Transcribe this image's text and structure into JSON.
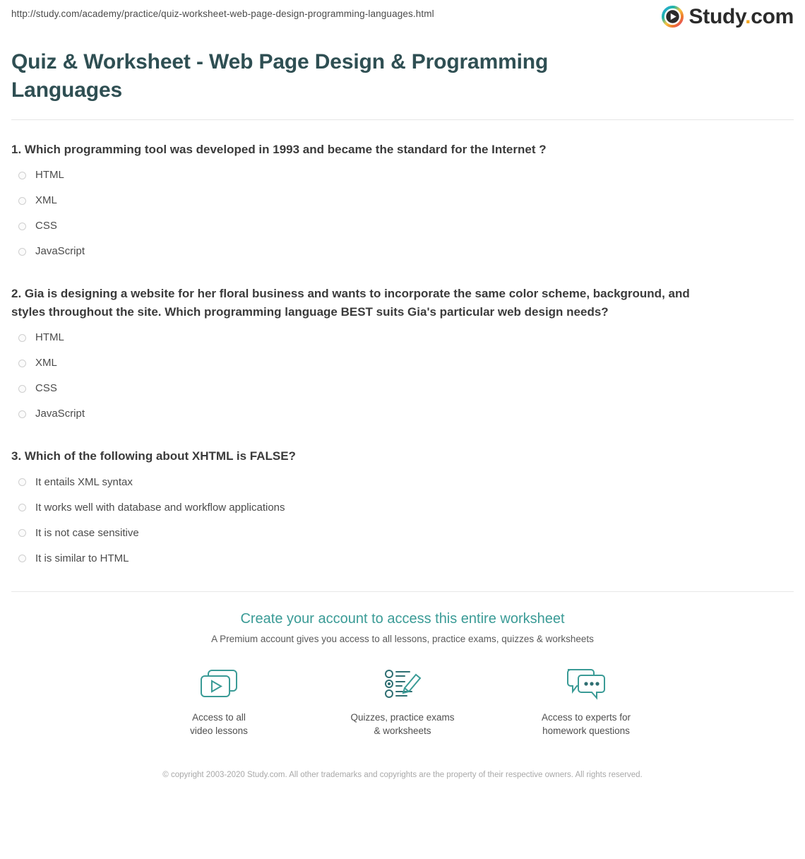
{
  "header": {
    "url": "http://study.com/academy/practice/quiz-worksheet-web-page-design-programming-languages.html",
    "logo_text": "Study",
    "logo_dot": ".",
    "logo_suffix": "com",
    "logo_icon": "play-circle-icon"
  },
  "page_title": "Quiz & Worksheet - Web Page Design & Programming Languages",
  "questions": [
    {
      "text": "1. Which programming tool was developed in 1993 and became the standard for the Internet ?",
      "options": [
        "HTML",
        "XML",
        "CSS",
        "JavaScript"
      ]
    },
    {
      "text": "2. Gia is designing a website for her floral business and wants to incorporate the same color scheme, background, and styles throughout the site. Which programming language BEST suits Gia's particular web design needs?",
      "options": [
        "HTML",
        "XML",
        "CSS",
        "JavaScript"
      ]
    },
    {
      "text": "3. Which of the following about XHTML is FALSE?",
      "options": [
        "It entails XML syntax",
        "It works well with database and workflow applications",
        "It is not case sensitive",
        "It is similar to HTML"
      ]
    }
  ],
  "cta": {
    "title": "Create your account to access this entire worksheet",
    "subtitle": "A Premium account gives you access to all lessons, practice exams, quizzes & worksheets",
    "features": [
      {
        "icon": "video-lessons-icon",
        "label_line1": "Access to all",
        "label_line2": "video lessons"
      },
      {
        "icon": "quiz-pencil-icon",
        "label_line1": "Quizzes, practice exams",
        "label_line2": "& worksheets"
      },
      {
        "icon": "chat-bubbles-icon",
        "label_line1": "Access to experts for",
        "label_line2": "homework questions"
      }
    ]
  },
  "copyright": "© copyright 2003-2020 Study.com. All other trademarks and copyrights are the property of their respective owners. All rights reserved.",
  "colors": {
    "title": "#2f4f53",
    "accent_teal": "#3a9b96",
    "logo_accent": "#f5a623"
  }
}
